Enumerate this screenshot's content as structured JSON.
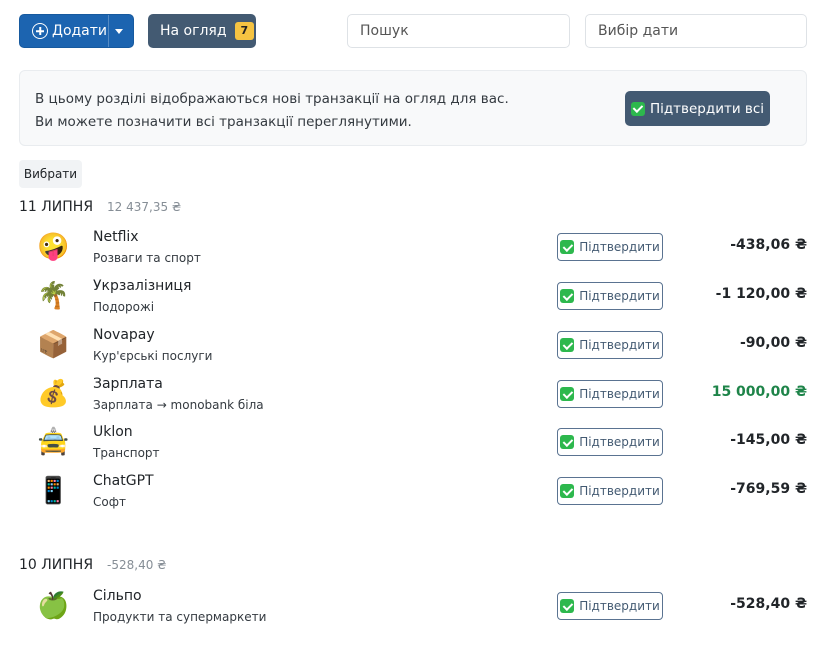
{
  "toolbar": {
    "add_label": "Додати",
    "review_label": "На огляд",
    "review_count": "7",
    "search_placeholder": "Пошук",
    "date_placeholder": "Вибір дати"
  },
  "info": {
    "line1": "В цьому розділі відображаються нові транзакції на огляд для вас.",
    "line2": "Ви можете позначити всі транзакції переглянутими.",
    "confirm_all_label": "Підтвердити всі"
  },
  "select_label": "Вибрати",
  "confirm_label": "Підтвердити",
  "groups": [
    {
      "date": "11 ЛИПНЯ",
      "total": "12 437,35 ₴",
      "transactions": [
        {
          "emoji": "🤪",
          "title": "Netflix",
          "category": "Розваги та спорт",
          "amount": "-438,06 ₴",
          "positive": false
        },
        {
          "emoji": "🌴",
          "title": "Укрзалізниця",
          "category": "Подорожі",
          "amount": "-1 120,00 ₴",
          "positive": false
        },
        {
          "emoji": "📦",
          "title": "Novapay",
          "category": "Кур'єрські послуги",
          "amount": "-90,00 ₴",
          "positive": false
        },
        {
          "emoji": "💰",
          "title": "Зарплата",
          "category": "Зарплата → monobank біла",
          "amount": "15 000,00 ₴",
          "positive": true
        },
        {
          "emoji": "🚖",
          "title": "Uklon",
          "category": "Транспорт",
          "amount": "-145,00 ₴",
          "positive": false
        },
        {
          "emoji": "📱",
          "title": "ChatGPT",
          "category": "Софт",
          "amount": "-769,59 ₴",
          "positive": false
        }
      ]
    },
    {
      "date": "10 ЛИПНЯ",
      "total": "-528,40 ₴",
      "transactions": [
        {
          "emoji": "🍏",
          "title": "Сільпо",
          "category": "Продукти та супермаркети",
          "amount": "-528,40 ₴",
          "positive": false
        }
      ]
    }
  ],
  "colors": {
    "primary": "#1c64b0",
    "secondary": "#435a72",
    "badge": "#f5c342",
    "positive": "#1e8449",
    "check": "#2db84d"
  }
}
